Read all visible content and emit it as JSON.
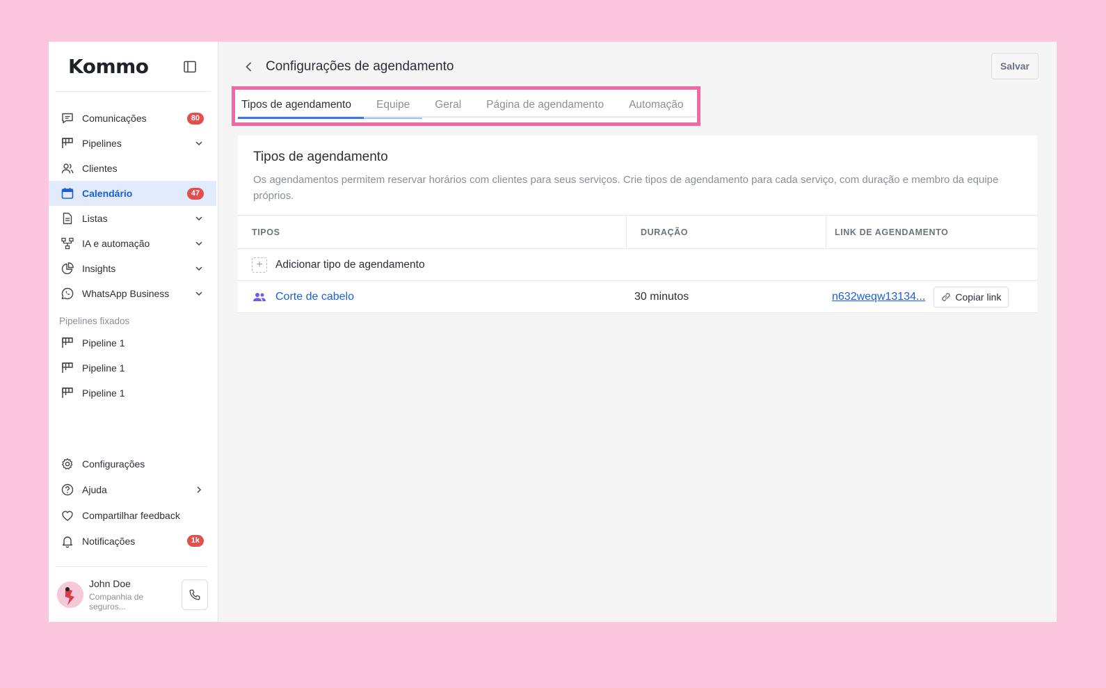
{
  "sidebar": {
    "logo": "Kommo",
    "items": [
      {
        "label": "Comunicações",
        "badge": "80"
      },
      {
        "label": "Pipelines"
      },
      {
        "label": "Clientes"
      },
      {
        "label": "Calendário",
        "badge": "47"
      },
      {
        "label": "Listas"
      },
      {
        "label": "IA e automação"
      },
      {
        "label": "Insights"
      },
      {
        "label": "WhatsApp Business"
      }
    ],
    "pinned_section": "Pipelines fixados",
    "pinned": [
      {
        "label": "Pipeline 1"
      },
      {
        "label": "Pipeline 1"
      },
      {
        "label": "Pipeline 1"
      }
    ],
    "bottom": [
      {
        "label": "Configurações"
      },
      {
        "label": "Ajuda"
      },
      {
        "label": "Compartilhar feedback"
      },
      {
        "label": "Notificações",
        "badge": "1k"
      }
    ],
    "user": {
      "name": "John Doe",
      "company": "Companhia de seguros..."
    }
  },
  "header": {
    "title": "Configurações de agendamento",
    "save_label": "Salvar"
  },
  "tabs": [
    {
      "label": "Tipos de agendamento"
    },
    {
      "label": "Equipe"
    },
    {
      "label": "Geral"
    },
    {
      "label": "Página de agendamento"
    },
    {
      "label": "Automação"
    }
  ],
  "card": {
    "title": "Tipos de agendamento",
    "description": "Os agendamentos permitem reservar horários com clientes para seus serviços. Crie tipos de agendamento para cada serviço, com duração e membro da equipe próprios.",
    "columns": [
      "TIPOS",
      "DURAÇÃO",
      "LINK DE AGENDAMENTO"
    ],
    "add_label": "Adicionar tipo de agendamento",
    "rows": [
      {
        "type": "Corte de cabelo",
        "duration": "30 minutos",
        "link": "n632weqw13134...",
        "copy_label": "Copiar link"
      }
    ]
  },
  "colors": {
    "background": "#fcc6df",
    "accent": "#1a5fd6",
    "highlight": "#ee6aa7",
    "badge": "#e1504d"
  }
}
